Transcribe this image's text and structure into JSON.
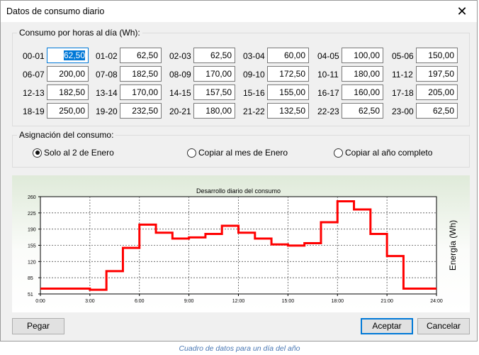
{
  "window": {
    "title": "Datos de consumo diario",
    "close_symbol": "✕"
  },
  "hours_group": {
    "legend": "Consumo por horas al día (Wh):",
    "cells": [
      {
        "label": "00-01",
        "value": "62,50",
        "selected": true
      },
      {
        "label": "01-02",
        "value": "62,50"
      },
      {
        "label": "02-03",
        "value": "62,50"
      },
      {
        "label": "03-04",
        "value": "60,00"
      },
      {
        "label": "04-05",
        "value": "100,00"
      },
      {
        "label": "05-06",
        "value": "150,00"
      },
      {
        "label": "06-07",
        "value": "200,00"
      },
      {
        "label": "07-08",
        "value": "182,50"
      },
      {
        "label": "08-09",
        "value": "170,00"
      },
      {
        "label": "09-10",
        "value": "172,50"
      },
      {
        "label": "10-11",
        "value": "180,00"
      },
      {
        "label": "11-12",
        "value": "197,50"
      },
      {
        "label": "12-13",
        "value": "182,50"
      },
      {
        "label": "13-14",
        "value": "170,00"
      },
      {
        "label": "14-15",
        "value": "157,50"
      },
      {
        "label": "15-16",
        "value": "155,00"
      },
      {
        "label": "16-17",
        "value": "160,00"
      },
      {
        "label": "17-18",
        "value": "205,00"
      },
      {
        "label": "18-19",
        "value": "250,00"
      },
      {
        "label": "19-20",
        "value": "232,50"
      },
      {
        "label": "20-21",
        "value": "180,00"
      },
      {
        "label": "21-22",
        "value": "132,50"
      },
      {
        "label": "22-23",
        "value": "62,50"
      },
      {
        "label": "23-00",
        "value": "62,50"
      }
    ]
  },
  "assign_group": {
    "legend": "Asignación del consumo:",
    "options": [
      {
        "label": "Solo al 2 de Enero",
        "checked": true
      },
      {
        "label": "Copiar al mes de Enero",
        "checked": false
      },
      {
        "label": "Copiar al año completo",
        "checked": false
      }
    ]
  },
  "chart_data": {
    "type": "line",
    "title": "Desarrollo diario del consumo",
    "ylabel": "Energía (Wh)",
    "xlabel": "",
    "x_ticks": [
      "0:00",
      "3:00",
      "6:00",
      "9:00",
      "12:00",
      "15:00",
      "18:00",
      "21:00",
      "24:00"
    ],
    "y_ticks": [
      "260",
      "225",
      "190",
      "155",
      "120",
      "85",
      "51"
    ],
    "ylim": [
      51,
      260
    ],
    "xlim": [
      0,
      24
    ],
    "grid": true,
    "series": [
      {
        "color": "#ff0000",
        "step": true,
        "x": [
          0,
          1,
          2,
          3,
          4,
          5,
          6,
          7,
          8,
          9,
          10,
          11,
          12,
          13,
          14,
          15,
          16,
          17,
          18,
          19,
          20,
          21,
          22,
          23
        ],
        "values": [
          62.5,
          62.5,
          62.5,
          60,
          100,
          150,
          200,
          182.5,
          170,
          172.5,
          180,
          197.5,
          182.5,
          170,
          157.5,
          155,
          160,
          205,
          250,
          232.5,
          180,
          132.5,
          62.5,
          62.5
        ]
      }
    ]
  },
  "buttons": {
    "paste": "Pegar",
    "accept": "Aceptar",
    "cancel": "Cancelar"
  },
  "caption": "Cuadro de datos para un día del año"
}
